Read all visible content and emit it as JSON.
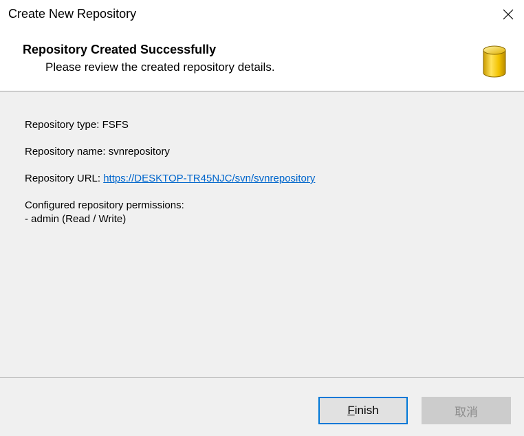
{
  "window": {
    "title": "Create New Repository"
  },
  "header": {
    "title": "Repository Created Successfully",
    "subtitle": "Please review the created repository details.",
    "icon": "database-icon"
  },
  "details": {
    "type_label": "Repository type: ",
    "type_value": "FSFS",
    "name_label": "Repository name: ",
    "name_value": "svnrepository",
    "url_label": "Repository URL: ",
    "url_value": "https://DESKTOP-TR45NJC/svn/svnrepository",
    "permissions_title": "Configured repository permissions:",
    "permissions": [
      "- admin (Read / Write)"
    ]
  },
  "buttons": {
    "finish_mnemonic": "F",
    "finish_rest": "inish",
    "cancel": "取消"
  },
  "colors": {
    "link": "#0066cc",
    "focus_border": "#0078d7",
    "db_icon": "#e8b800"
  }
}
